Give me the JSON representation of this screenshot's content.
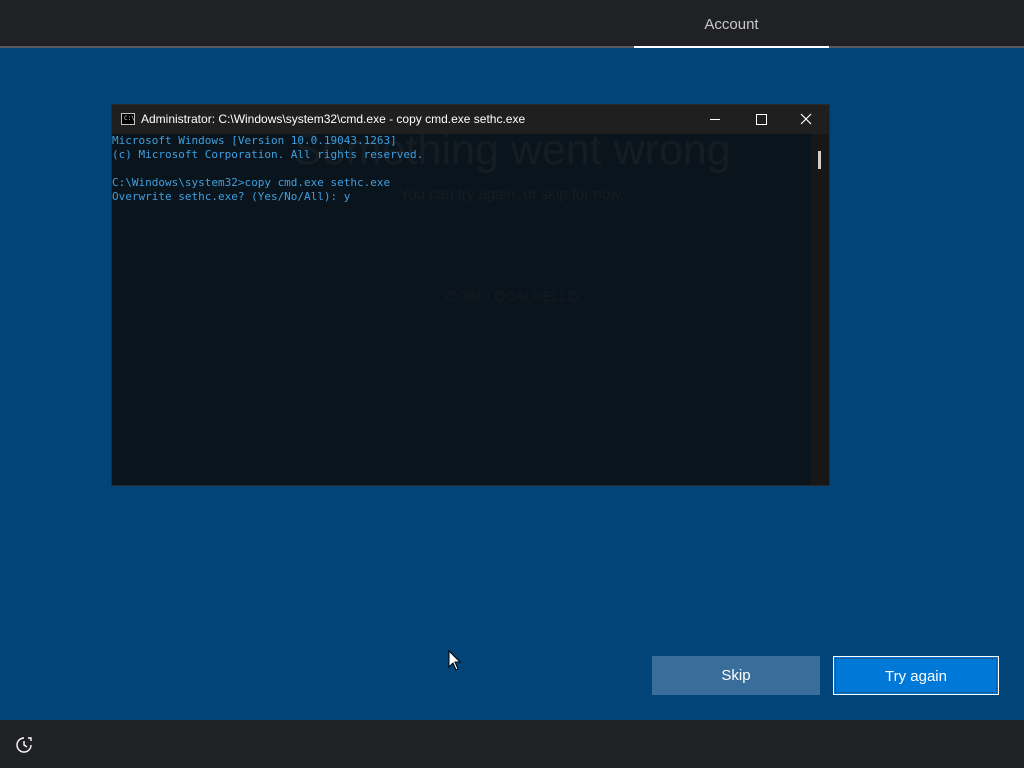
{
  "header": {
    "account_tab": "Account"
  },
  "oobe": {
    "error_title": "Something went wrong",
    "error_subtitle": "You can try again, or skip for now.",
    "error_code": "OOBELOCALHELLO",
    "skip_label": "Skip",
    "try_again_label": "Try again"
  },
  "cmd": {
    "title": "Administrator: C:\\Windows\\system32\\cmd.exe - copy  cmd.exe sethc.exe",
    "lines": [
      "Microsoft Windows [Version 10.0.19043.1263]",
      "(c) Microsoft Corporation. All rights reserved.",
      "",
      "C:\\Windows\\system32>copy cmd.exe sethc.exe",
      "Overwrite sethc.exe? (Yes/No/All): y"
    ],
    "text_color": "#3f9fe0"
  },
  "icons": {
    "cmd": "cmd-icon",
    "minimize": "minimize-icon",
    "maximize": "maximize-icon",
    "close": "close-icon",
    "ease_of_access": "ease-of-access-icon",
    "cursor": "mouse-cursor-icon"
  },
  "colors": {
    "background": "#024477",
    "bar": "#202124",
    "primary_button": "#0078d7",
    "secondary_button": "#3a6e9a"
  }
}
